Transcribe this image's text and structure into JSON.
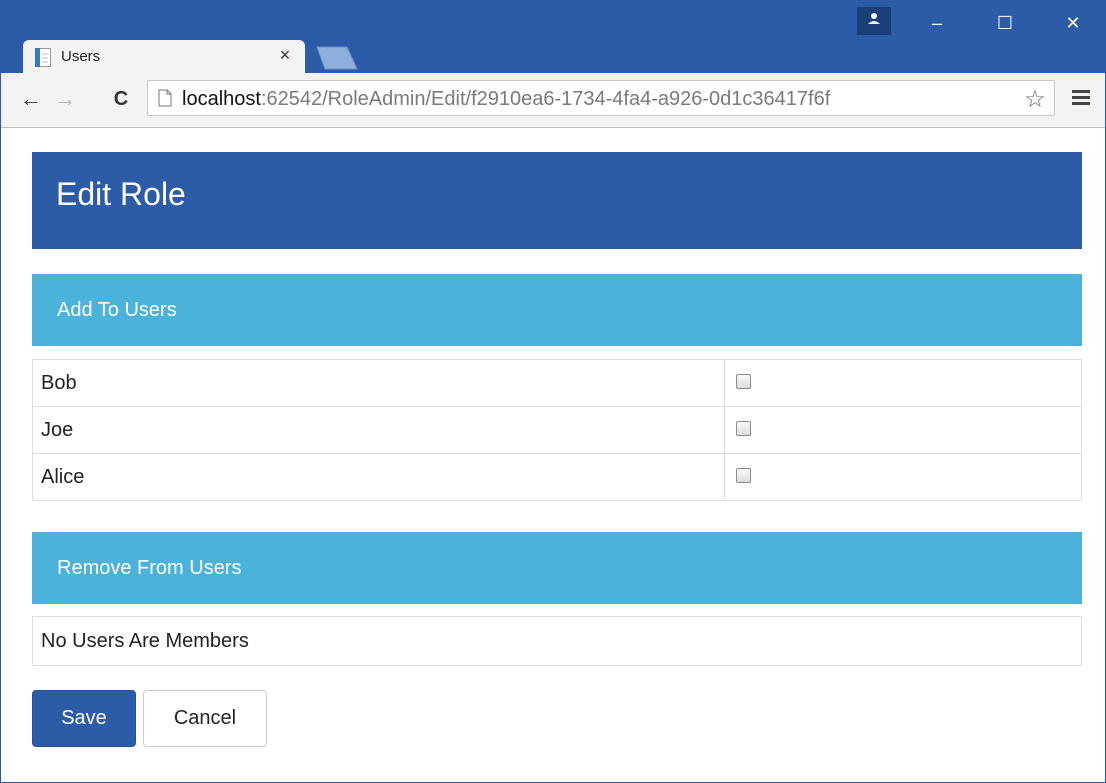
{
  "browser": {
    "tab_title": "Users",
    "tab_close": "×",
    "url_host": "localhost",
    "url_rest": ":62542/RoleAdmin/Edit/f2910ea6-1734-4fa4-a926-0d1c36417f6f",
    "window_minimize": "–",
    "window_maximize": "☐",
    "window_close": "✕",
    "nav_back": "←",
    "nav_forward": "→",
    "nav_reload": "C",
    "bookmark_star": "☆"
  },
  "page": {
    "title": "Edit Role",
    "add_section": {
      "title": "Add To Users",
      "users": [
        {
          "name": "Bob",
          "checked": false
        },
        {
          "name": "Joe",
          "checked": false
        },
        {
          "name": "Alice",
          "checked": false
        }
      ]
    },
    "remove_section": {
      "title": "Remove From Users",
      "empty_message": "No Users Are Members"
    },
    "buttons": {
      "save": "Save",
      "cancel": "Cancel"
    }
  },
  "colors": {
    "primary": "#2c5ca8",
    "info": "#4bb3d9"
  },
  "icons": [
    "page-favicon-icon",
    "new-tab-icon",
    "profile-icon",
    "back-arrow-icon",
    "forward-arrow-icon",
    "reload-icon",
    "page-icon",
    "star-icon",
    "menu-icon"
  ]
}
